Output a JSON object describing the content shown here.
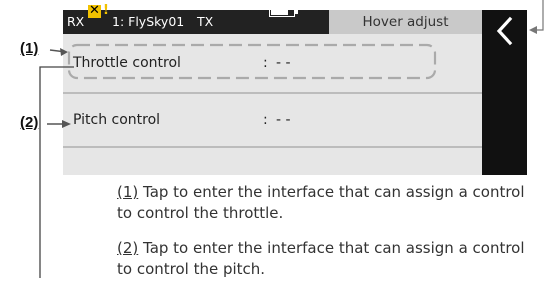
{
  "status_bar": {
    "rx_label": "RX",
    "rx_mark": "✕",
    "warn_mark": "!",
    "model_label": "1: FlySky01",
    "tx_label": "TX",
    "title": "Hover adjust"
  },
  "rows": [
    {
      "label": "Throttle control",
      "separator": ":",
      "value": "- -"
    },
    {
      "label": "Pitch control",
      "separator": ":",
      "value": "- -"
    }
  ],
  "annotations": [
    {
      "number": "(1)"
    },
    {
      "number": "(2)"
    }
  ],
  "descriptions": [
    {
      "number": "(1)",
      "text": " Tap to enter the interface that can assign a control to control the throttle."
    },
    {
      "number": "(2)",
      "text": " Tap to enter the interface that can assign a control to control the pitch."
    }
  ],
  "icons": {
    "back": "chevron-left-icon",
    "battery": "battery-icon"
  },
  "colors": {
    "status_bar": "#222222",
    "warning": "#f2c200",
    "title_box": "#c9c9c9",
    "content": "#e6e6e6",
    "back_panel": "#111111"
  }
}
